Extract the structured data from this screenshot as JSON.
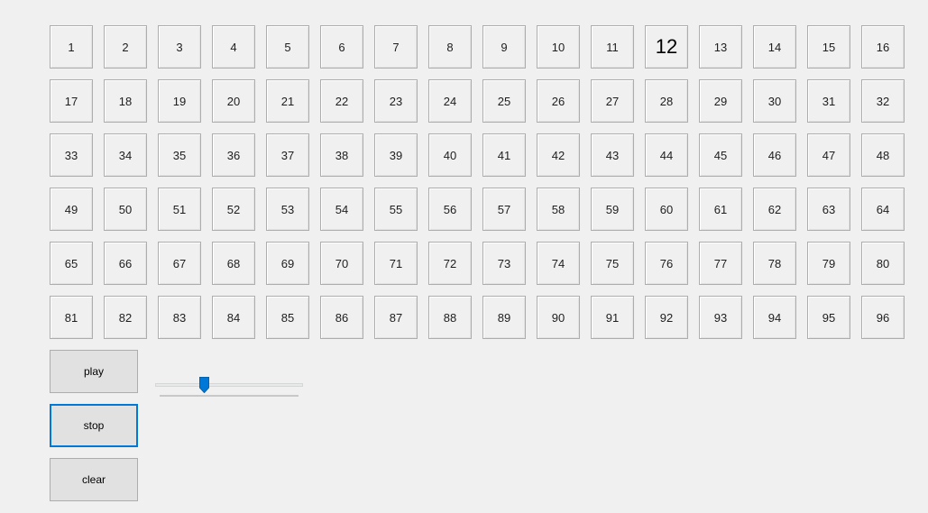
{
  "grid": {
    "cells": [
      "1",
      "2",
      "3",
      "4",
      "5",
      "6",
      "7",
      "8",
      "9",
      "10",
      "11",
      "12",
      "13",
      "14",
      "15",
      "16",
      "17",
      "18",
      "19",
      "20",
      "21",
      "22",
      "23",
      "24",
      "25",
      "26",
      "27",
      "28",
      "29",
      "30",
      "31",
      "32",
      "33",
      "34",
      "35",
      "36",
      "37",
      "38",
      "39",
      "40",
      "41",
      "42",
      "43",
      "44",
      "45",
      "46",
      "47",
      "48",
      "49",
      "50",
      "51",
      "52",
      "53",
      "54",
      "55",
      "56",
      "57",
      "58",
      "59",
      "60",
      "61",
      "62",
      "63",
      "64",
      "65",
      "66",
      "67",
      "68",
      "69",
      "70",
      "71",
      "72",
      "73",
      "74",
      "75",
      "76",
      "77",
      "78",
      "79",
      "80",
      "81",
      "82",
      "83",
      "84",
      "85",
      "86",
      "87",
      "88",
      "89",
      "90",
      "91",
      "92",
      "93",
      "94",
      "95",
      "96"
    ],
    "highlighted_cell": "12"
  },
  "controls": {
    "play_label": "play",
    "stop_label": "stop",
    "clear_label": "clear",
    "focused": "stop"
  },
  "slider": {
    "value_fraction": 0.32
  },
  "colors": {
    "background": "#f0f0f0",
    "accent": "#0078d7",
    "button_face": "#e1e1e1",
    "border": "#adadad"
  },
  "icons": {
    "slider_thumb": "slider-thumb-icon"
  }
}
